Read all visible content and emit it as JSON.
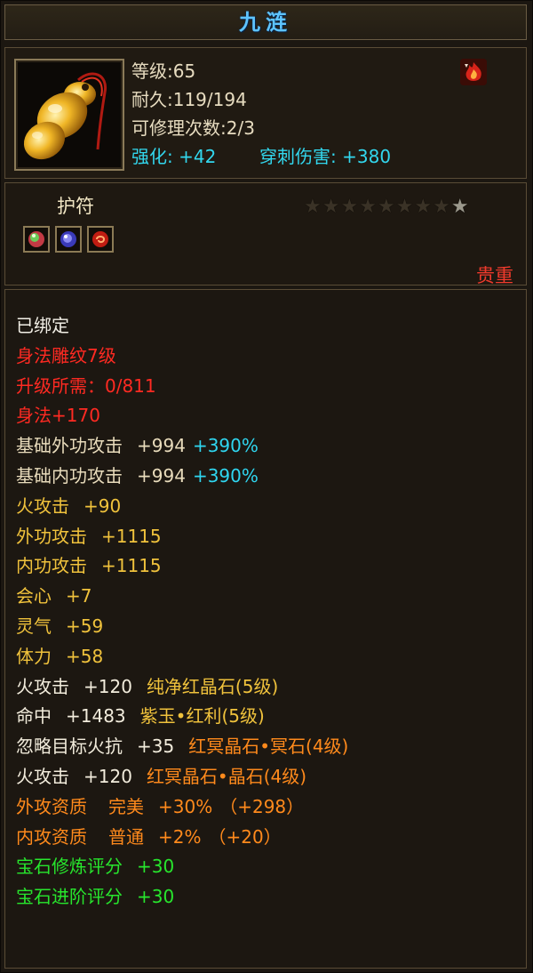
{
  "window": {
    "title": "九涟"
  },
  "item": {
    "stats": {
      "level": "等级:65",
      "durability": "耐久:119/194",
      "repairs": "可修理次数:2/3",
      "strengthen_label": "强化:",
      "strengthen_value": "+42",
      "pierce_label": "穿刺伤害:",
      "pierce_value": "+380"
    },
    "type": "护符",
    "stars_total": 9,
    "stars_lit": 1,
    "rarity": "贵重",
    "icon": "jade-gourd-amulet-icon",
    "badge_icon": "flame-badge-icon",
    "gem_slots": [
      "green-gem-icon",
      "blue-gem-icon",
      "red-gem-icon"
    ]
  },
  "attributes": {
    "bound": "已绑定",
    "engrave": "身法雕纹7级",
    "upgrade_need": "升级所需：0/811",
    "agility": "身法+170",
    "base_ext_atk": {
      "label": "基础外功攻击",
      "value": "+994",
      "pct": "+390%"
    },
    "base_int_atk": {
      "label": "基础内功攻击",
      "value": "+994",
      "pct": "+390%"
    },
    "fire_atk": {
      "label": "火攻击",
      "value": "+90"
    },
    "ext_atk": {
      "label": "外功攻击",
      "value": "+1115"
    },
    "int_atk": {
      "label": "内功攻击",
      "value": "+1115"
    },
    "crit": {
      "label": "会心",
      "value": "+7"
    },
    "spirit": {
      "label": "灵气",
      "value": "+59"
    },
    "stamina": {
      "label": "体力",
      "value": "+58"
    },
    "gem1": {
      "label": "火攻击",
      "value": "+120",
      "gem": "纯净红晶石(5级)"
    },
    "gem2": {
      "label": "命中",
      "value": "+1483",
      "gem": "紫玉•红利(5级)"
    },
    "gem3": {
      "label": "忽略目标火抗",
      "value": "+35",
      "gem": "红冥晶石•冥石(4级)"
    },
    "gem4": {
      "label": "火攻击",
      "value": "+120",
      "gem": "红冥晶石•晶石(4级)"
    },
    "ext_aptitude": {
      "label": "外攻资质",
      "grade": "完美",
      "value": "+30%",
      "extra": "（+298）"
    },
    "int_aptitude": {
      "label": "内攻资质",
      "grade": "普通",
      "value": "+2%",
      "extra": "（+20）"
    },
    "gem_refine": {
      "label": "宝石修炼评分",
      "value": "+30"
    },
    "gem_advance": {
      "label": "宝石进阶评分",
      "value": "+30"
    }
  },
  "colors": {
    "title": "#5ec4ff",
    "cyan": "#2fd6f0",
    "red": "#ff2a22",
    "gold": "#f0c23c",
    "orange": "#ff8a1c",
    "green": "#27e62d",
    "rarity": "#f03a2c"
  }
}
